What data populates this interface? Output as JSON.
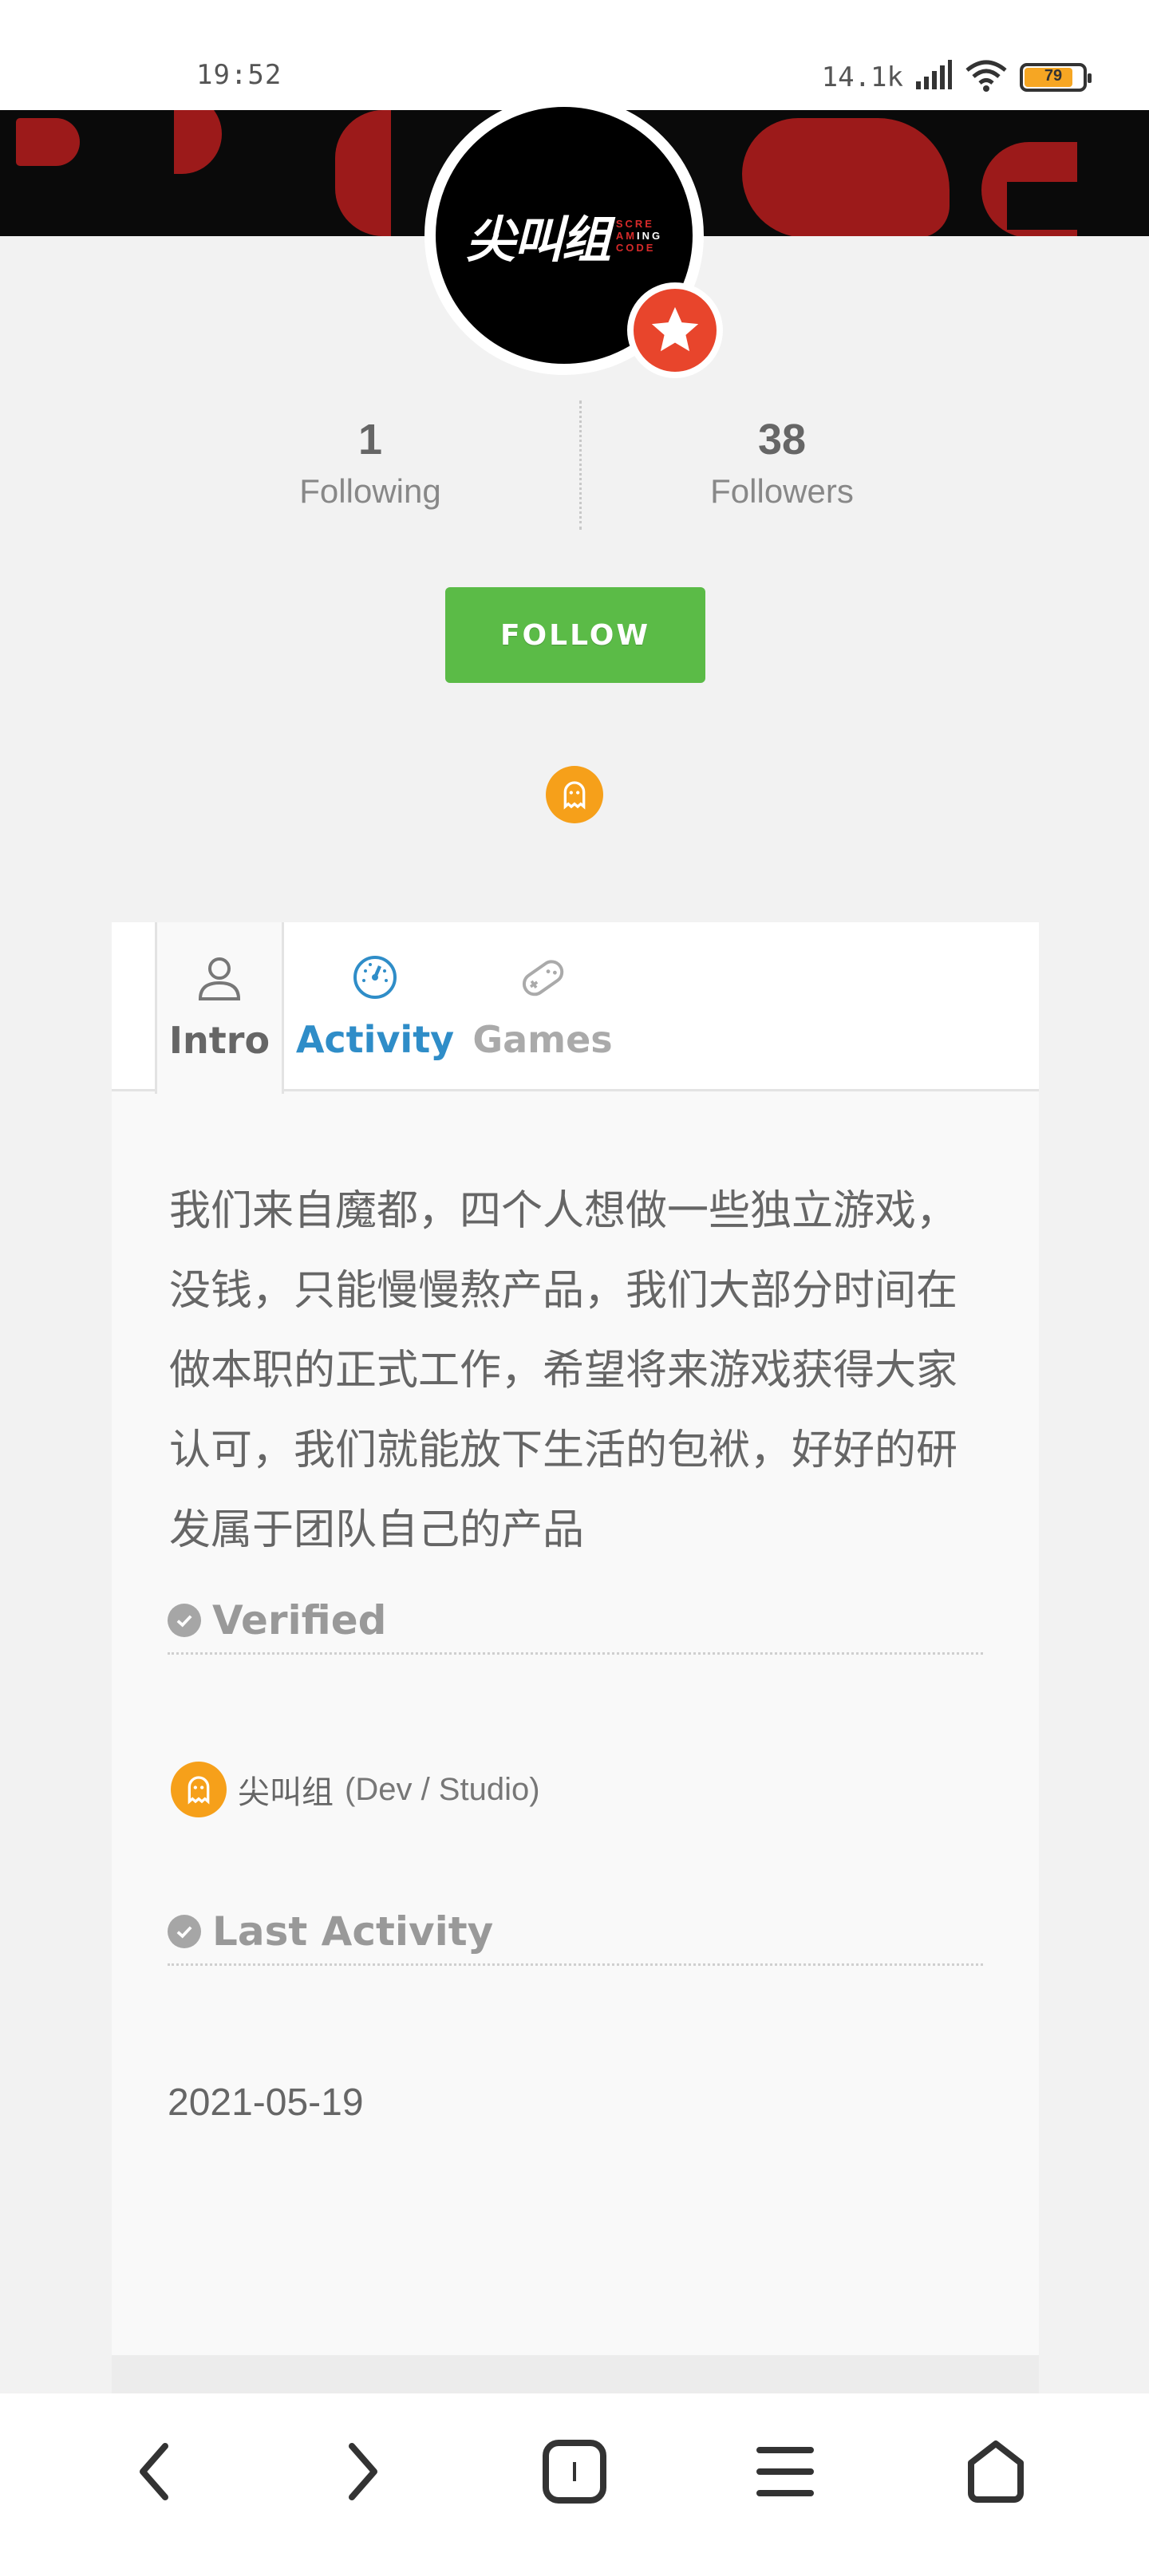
{
  "status_bar": {
    "time": "19:52",
    "net_speed": "14.1k",
    "battery_level": "79"
  },
  "profile": {
    "avatar_cn": "尖叫组",
    "avatar_en_line1": "SCRE",
    "avatar_en_line2a": "AM",
    "avatar_en_line2b": "ING",
    "avatar_en_line3": "CODE"
  },
  "stats": {
    "following_count": "1",
    "following_label": "Following",
    "followers_count": "38",
    "followers_label": "Followers"
  },
  "follow_button": "FOLLOW",
  "tabs": {
    "intro": "Intro",
    "activity": "Activity",
    "games": "Games"
  },
  "bio": "我们来自魔都，四个人想做一些独立游戏，没钱，只能慢慢熬产品，我们大部分时间在做本职的正式工作，希望将来游戏获得大家认可，我们就能放下生活的包袱，好好的研发属于团队自己的产品",
  "verified": {
    "title": "Verified",
    "name": "尖叫组",
    "role": "(Dev / Studio)"
  },
  "last_activity": {
    "title": "Last Activity",
    "date": "2021-05-19"
  },
  "colors": {
    "follow_green": "#5bbb47",
    "activity_blue": "#2f8dc8",
    "badge_orange": "#f6a01a",
    "star_red": "#e8452c"
  },
  "icons": [
    "signal-icon",
    "wifi-icon",
    "battery-icon",
    "star-icon",
    "ghost-icon",
    "user-icon",
    "dashboard-icon",
    "gamepad-icon",
    "check-circle-icon",
    "back-icon",
    "forward-icon",
    "tabs-icon",
    "menu-icon",
    "home-icon"
  ]
}
